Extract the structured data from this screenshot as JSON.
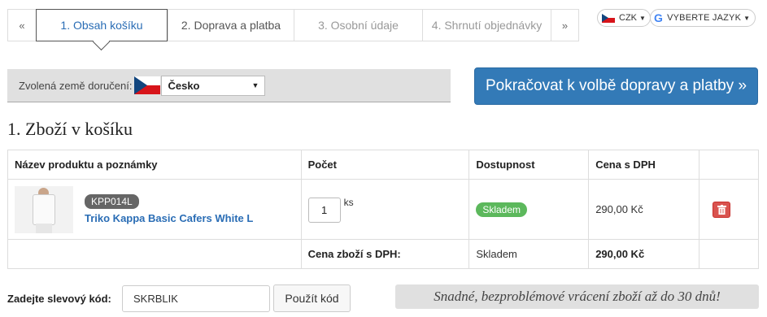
{
  "steps": {
    "prev": "«",
    "next": "»",
    "items": [
      {
        "label": "1. Obsah košíku"
      },
      {
        "label": "2. Doprava a platba"
      },
      {
        "label": "3. Osobní údaje"
      },
      {
        "label": "4. Shrnutí objednávky"
      }
    ]
  },
  "currency": {
    "label": "CZK"
  },
  "language": {
    "icon": "G",
    "label": "VYBERTE JAZYK"
  },
  "country": {
    "label": "Zvolená země doručení:",
    "selected": "Česko"
  },
  "continue_button": "Pokračovat k volbě dopravy a platby »",
  "cart": {
    "title": "1. Zboží v košíku",
    "headers": [
      "Název produktu a poznámky",
      "Počet",
      "Dostupnost",
      "Cena s DPH"
    ],
    "items": [
      {
        "code": "KPP014L",
        "name": "Triko Kappa Basic Cafers White L",
        "quantity": "1",
        "unit": "ks",
        "availability": "Skladem",
        "price": "290,00 Kč"
      }
    ],
    "total": {
      "label": "Cena zboží s DPH:",
      "availability": "Skladem",
      "price": "290,00 Kč"
    }
  },
  "discount": {
    "label": "Zadejte slevový kód:",
    "value": "SKRBLIK",
    "apply_button": "Použít kód"
  },
  "returns_note": "Snadné, bezproblémové vrácení zboží až do 30 dnů!",
  "colors": {
    "primary": "#337ab7",
    "link": "#2a6db5",
    "success": "#5cb85c",
    "danger": "#d9534f"
  }
}
